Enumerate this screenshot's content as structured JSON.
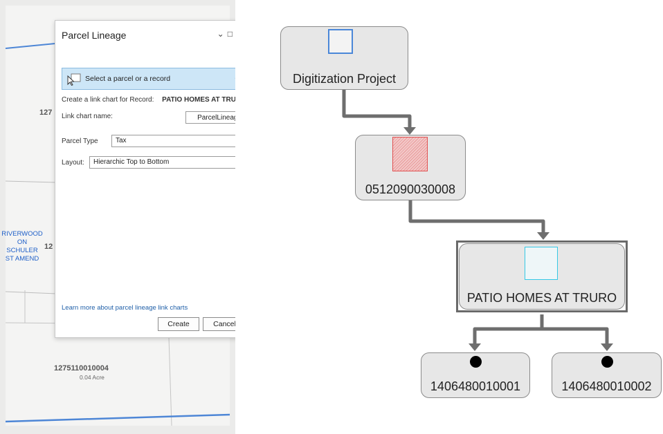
{
  "map": {
    "labels": {
      "lot_top": "127",
      "lot_mid": "12",
      "riverwood": "RIVERWOOD ON SCHULER ST AMEND",
      "parcel": "1275110010004",
      "acre": "0.04 Acre"
    },
    "colors": {
      "boundary": "#4d86d6",
      "riverwood_text": "#1e5fc8"
    }
  },
  "dialog": {
    "title": "Parcel Lineage",
    "selector_label": "Select a parcel or a record",
    "record_label": "Create a link chart for Record:",
    "record_value": "PATIO HOMES AT TRURO",
    "link_chart_name_label": "Link chart name:",
    "link_chart_name_value": "ParcelLineage",
    "parcel_type_label": "Parcel Type",
    "parcel_type_value": "Tax",
    "layout_label": "Layout:",
    "layout_value": "Hierarchic Top to Bottom",
    "learn_more": "Learn more about parcel lineage link charts",
    "create_button": "Create",
    "cancel_button": "Cancel",
    "selector_bg": "#cde6f7"
  },
  "link_chart": {
    "nodes": {
      "project": "Digitization Project",
      "parcel_parent": "0512090030008",
      "record": "PATIO HOMES AT TRURO",
      "child_1": "1406480010001",
      "child_2": "1406480010002"
    },
    "colors": {
      "node_fill": "#e7e7e7",
      "connector": "#6e6e6e",
      "project_symbol": "#4a87d8",
      "parcel_symbol": "#e05050",
      "record_symbol": "#34c9e6"
    }
  }
}
